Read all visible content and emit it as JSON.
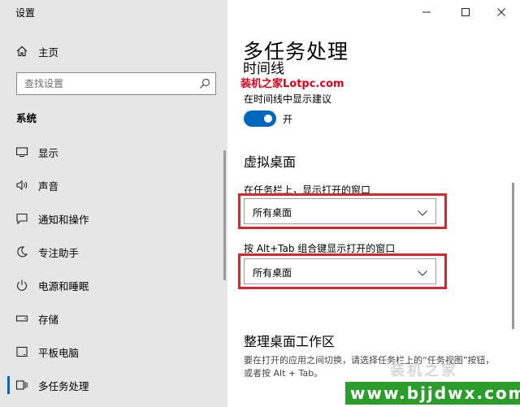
{
  "window": {
    "title": "设置",
    "minimize_icon": "minimize-icon",
    "maximize_icon": "maximize-icon",
    "close_icon": "close-icon"
  },
  "sidebar": {
    "home_label": "主页",
    "search_placeholder": "查找设置",
    "section_title": "系统",
    "items": [
      {
        "label": "显示",
        "icon": "display-icon"
      },
      {
        "label": "声音",
        "icon": "speaker-icon"
      },
      {
        "label": "通知和操作",
        "icon": "notification-icon"
      },
      {
        "label": "专注助手",
        "icon": "moon-icon"
      },
      {
        "label": "电源和睡眠",
        "icon": "power-icon"
      },
      {
        "label": "存储",
        "icon": "storage-icon"
      },
      {
        "label": "平板电脑",
        "icon": "tablet-icon"
      },
      {
        "label": "多任务处理",
        "icon": "multitask-icon"
      }
    ],
    "active_index": 7
  },
  "main": {
    "page_title": "多任务处理",
    "timeline_heading": "时间线",
    "timeline_suggest_label": "在时间线中显示建议",
    "toggle_state": "开",
    "toggle_on": true,
    "virtual_desktops_heading": "虚拟桌面",
    "taskbar_label": "在任务栏上，显示打开的窗口",
    "taskbar_value": "所有桌面",
    "alttab_label": "按 Alt+Tab 组合键显示打开的窗口",
    "alttab_value": "所有桌面",
    "work_area_heading": "整理桌面工作区",
    "work_area_desc": "要在打开的应用之间切换，请选择任务栏上的“任务视图”按钮，或者按 Alt + Tab。"
  },
  "watermarks": {
    "top": "装机之家Lotpc.com",
    "bottom": "www.bjjdwx.com",
    "logo": "装机之家"
  },
  "colors": {
    "accent": "#0067c0",
    "sidebar_bg": "#e6e6e6",
    "highlight_frame": "#d9262c",
    "watermark_red": "#e3001b",
    "watermark_green": "#2a9d2a"
  }
}
